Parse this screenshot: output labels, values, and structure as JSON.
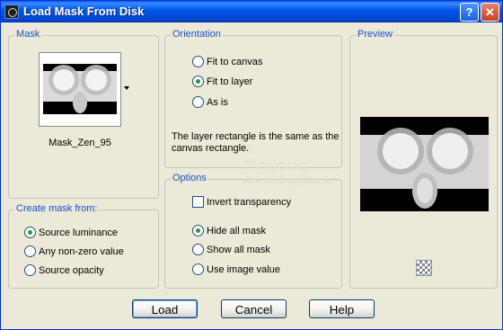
{
  "window": {
    "title": "Load Mask From Disk",
    "help_glyph": "?",
    "close_glyph": "✕",
    "icon": "app-icon"
  },
  "mask": {
    "group_title": "Mask",
    "mask_name": "Mask_Zen_95"
  },
  "orientation": {
    "group_title": "Orientation",
    "options": [
      "Fit to canvas",
      "Fit to layer",
      "As is"
    ],
    "selected": "Fit to layer",
    "description": "The layer rectangle is the same as the canvas rectangle."
  },
  "preview": {
    "group_title": "Preview"
  },
  "create_mask_from": {
    "group_title": "Create mask from:",
    "options": [
      "Source luminance",
      "Any non-zero value",
      "Source opacity"
    ],
    "selected": "Source luminance"
  },
  "options": {
    "group_title": "Options",
    "invert_transparency_label": "Invert transparency",
    "invert_transparency_checked": false,
    "mask_options": [
      "Hide all mask",
      "Show all mask",
      "Use image value"
    ],
    "selected": "Hide all mask"
  },
  "buttons": {
    "load": "Load",
    "cancel": "Cancel",
    "help": "Help"
  },
  "watermark": {
    "name": "Pinuccia",
    "url": "www.maidiregrafica.eu"
  },
  "colors": {
    "dialog_bg": "#ece9d8",
    "title_bar": "#0058e6",
    "group_title_text": "#1f4fc7",
    "radio_selected": "#21a121"
  }
}
